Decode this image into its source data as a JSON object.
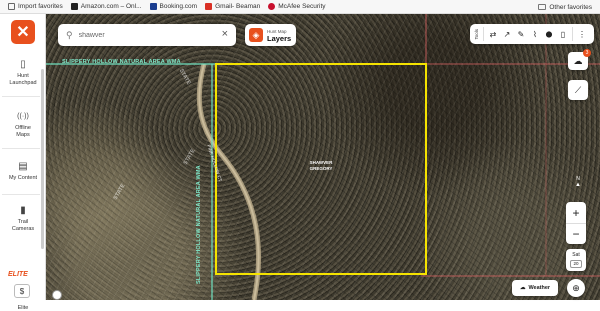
{
  "bookmarks": {
    "items": [
      {
        "label": "Import favorites",
        "icon": "import-icon"
      },
      {
        "label": "Amazon.com – Onl...",
        "icon": "amazon-icon"
      },
      {
        "label": "Booking.com",
        "icon": "booking-icon"
      },
      {
        "label": "Gmail- Beaman",
        "icon": "gmail-icon"
      },
      {
        "label": "McAfee Security",
        "icon": "mcafee-icon"
      }
    ],
    "other": "Other favorites"
  },
  "sidebar": {
    "logo": "✕",
    "items": [
      {
        "label1": "Hunt",
        "label2": "Launchpad",
        "icon": "phone-icon",
        "glyph": "▯"
      },
      {
        "label1": "Offline",
        "label2": "Maps",
        "icon": "offline-icon",
        "glyph": "((·))"
      },
      {
        "label1": "My Content",
        "label2": "",
        "icon": "content-icon",
        "glyph": "▤"
      },
      {
        "label1": "Trail",
        "label2": "Cameras",
        "icon": "camera-icon",
        "glyph": "▮"
      }
    ],
    "elite_tag": "ELITE",
    "elite_icon_glyph": "$",
    "elite_label": "Elite"
  },
  "search": {
    "value": "shawver",
    "placeholder": "Search",
    "clear": "×"
  },
  "layers": {
    "small": "Hunt Map",
    "big": "Layers"
  },
  "tools": {
    "label": "Tools",
    "glyphs": [
      "⇄",
      "↗",
      "✎",
      "⌇",
      "⬤",
      "▯",
      "⋮"
    ],
    "notif_count": "3"
  },
  "map": {
    "wma_top": "SLIPPERY HOLLOW NATURAL AREA WMA",
    "wma_left": "SLIPPERY HOLLOW NATURAL AREA WMA",
    "state_labels": [
      "STATE",
      "STATE",
      "STATE"
    ],
    "road": "PINE HOLLOW CT",
    "owner_line1": "SHAWVER",
    "owner_line2": "GREGORY",
    "boundary_color": "#f5e300",
    "property_line_color": "#e06666"
  },
  "controls": {
    "north": "N",
    "zoom_in": "+",
    "zoom_out": "−",
    "sat_label": "Sat",
    "zoom_level": "20",
    "weather": "Weather",
    "locate": "⊕"
  }
}
